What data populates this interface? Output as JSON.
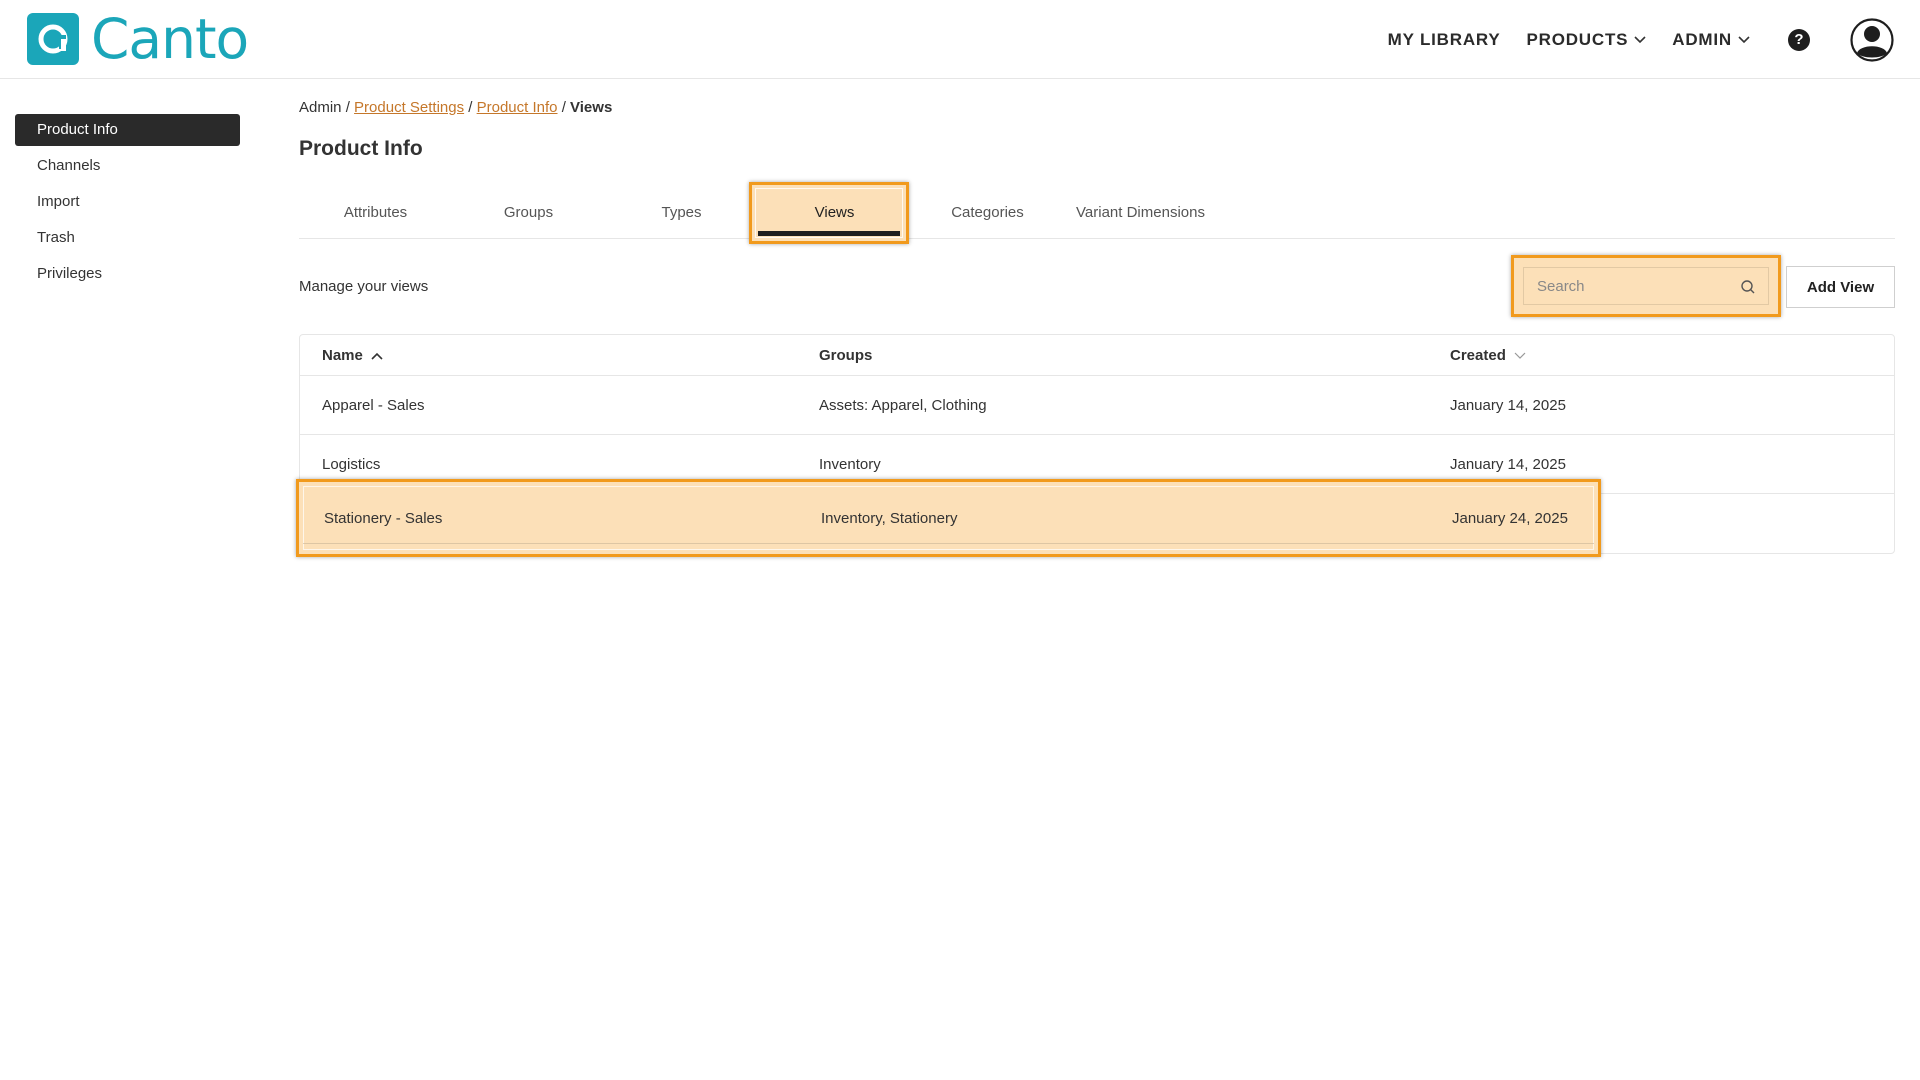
{
  "brand": {
    "name": "Canto",
    "color": "#1ba6b9"
  },
  "topnav": {
    "my_library": "MY LIBRARY",
    "products": "PRODUCTS",
    "admin": "ADMIN",
    "help": "?"
  },
  "sidebar": {
    "items": [
      {
        "label": "Product Info",
        "active": true
      },
      {
        "label": "Channels"
      },
      {
        "label": "Import"
      },
      {
        "label": "Trash"
      },
      {
        "label": "Privileges"
      }
    ]
  },
  "breadcrumb": {
    "root": "Admin",
    "sep": "/",
    "link1": "Product Settings",
    "link2": "Product Info",
    "current": "Views"
  },
  "page_title": "Product Info",
  "tabs": [
    {
      "label": "Attributes"
    },
    {
      "label": "Groups"
    },
    {
      "label": "Types"
    },
    {
      "label": "Views",
      "active": true
    },
    {
      "label": "Categories"
    },
    {
      "label": "Variant Dimensions"
    }
  ],
  "toolbar": {
    "label": "Manage your views",
    "search_placeholder": "Search",
    "add_label": "Add View"
  },
  "table": {
    "headers": {
      "name": "Name",
      "groups": "Groups",
      "created": "Created"
    },
    "rows": [
      {
        "name": "Apparel - Sales",
        "groups": "Assets: Apparel, Clothing",
        "created": "January 14, 2025"
      },
      {
        "name": "Logistics",
        "groups": "Inventory",
        "created": "January 14, 2025"
      },
      {
        "name": "Stationery - Sales",
        "groups": "Inventory, Stationery",
        "created": "January 24, 2025"
      }
    ]
  },
  "colors": {
    "highlight_border": "#f19a1d",
    "highlight_fill": "#fce0b8",
    "link": "#c5772a"
  }
}
